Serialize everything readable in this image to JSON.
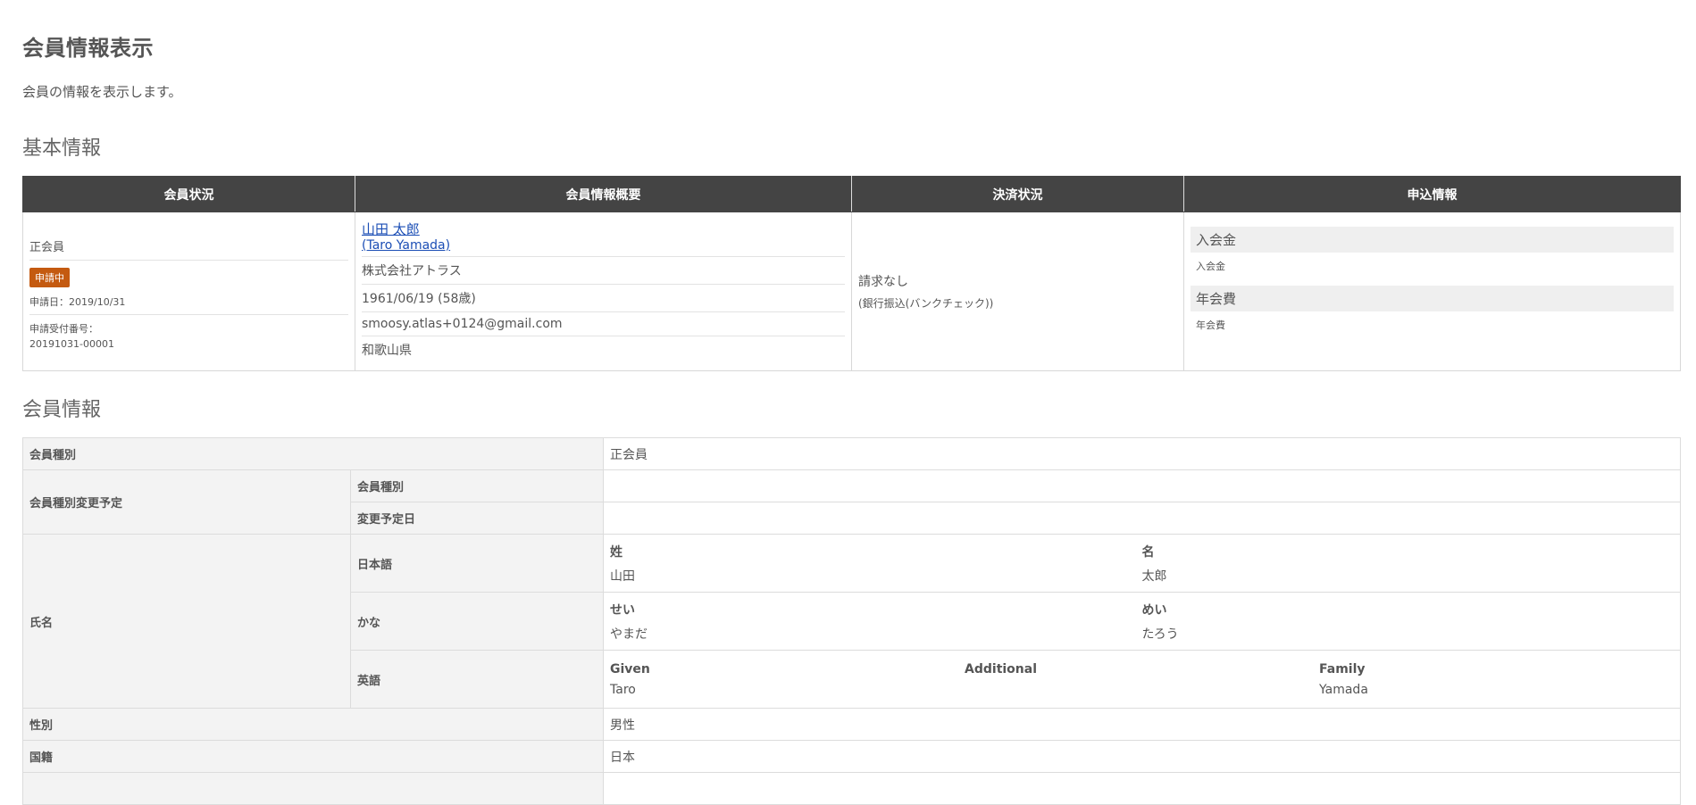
{
  "page": {
    "title": "会員情報表示",
    "description": "会員の情報を表示します。"
  },
  "section_basic": {
    "title": "基本情報"
  },
  "summary": {
    "headers": [
      "会員状況",
      "会員情報概要",
      "決済状況",
      "申込情報"
    ],
    "status": {
      "member_type": "正会員",
      "badge": "申請中",
      "date": "申請日：2019/10/31",
      "receipt_label": "申請受付番号：",
      "receipt_number": "20191031-00001"
    },
    "overview": {
      "name_ja": "山田 太郎",
      "name_en": "(Taro Yamada)",
      "company": "株式会社アトラス",
      "birthday": "1961/06/19 (58歳)",
      "email": "smoosy.atlas+0124@gmail.com",
      "prefecture": "和歌山県"
    },
    "payment": {
      "status": "請求なし",
      "method": "(銀行振込(バンクチェック))"
    },
    "application": {
      "entrance_fee_header": "入会金",
      "entrance_fee_value": "入会金",
      "annual_fee_header": "年会費",
      "annual_fee_value": "年会費"
    }
  },
  "section_member": {
    "title": "会員情報"
  },
  "details": {
    "member_type_label": "会員種別",
    "member_type_value": "正会員",
    "change_label": "会員種別変更予定",
    "change_type_label": "会員種別",
    "change_type_value": "",
    "change_date_label": "変更予定日",
    "change_date_value": "",
    "name_label": "氏名",
    "japanese_label": "日本語",
    "last_name_label": "姓",
    "last_name_value": "山田",
    "first_name_label": "名",
    "first_name_value": "太郎",
    "kana_label": "かな",
    "last_kana_label": "せい",
    "last_kana_value": "やまだ",
    "first_kana_label": "めい",
    "first_kana_value": "たろう",
    "english_label": "英語",
    "given_label": "Given",
    "given_value": "Taro",
    "additional_label": "Additional",
    "additional_value": "",
    "family_label": "Family",
    "family_value": "Yamada",
    "gender_label": "性別",
    "gender_value": "男性",
    "nationality_label": "国籍",
    "nationality_value": "日本"
  },
  "colors": {
    "header_bg": "#444444",
    "badge_bg": "#c45a10",
    "link": "#1a4db5",
    "label_bg": "#f3f3f3"
  }
}
